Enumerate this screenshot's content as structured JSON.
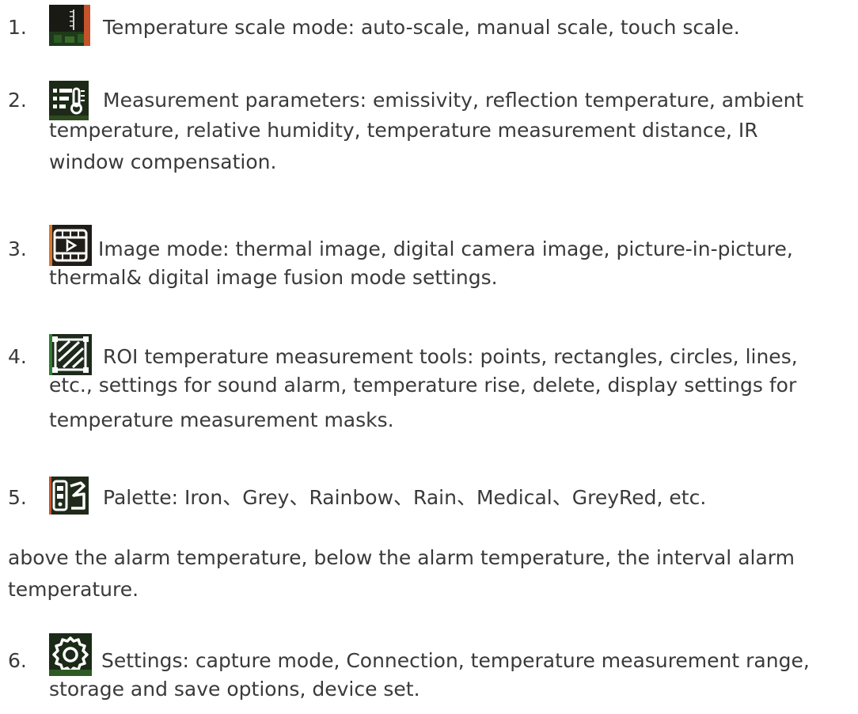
{
  "items": [
    {
      "number": "1.",
      "icon": "temperature-scale-icon",
      "lines": [
        "Temperature scale mode: auto-scale, manual scale, touch scale."
      ]
    },
    {
      "number": "2.",
      "icon": "measurement-parameters-icon",
      "lines": [
        "Measurement parameters: emissivity, reflection temperature, ambient",
        "temperature, relative humidity, temperature measurement distance, IR",
        "window compensation."
      ]
    },
    {
      "number": "3.",
      "icon": "image-mode-icon",
      "lines": [
        "Image mode: thermal image, digital camera image, picture-in-picture,",
        "thermal& digital image fusion mode settings."
      ]
    },
    {
      "number": "4.",
      "icon": "roi-tools-icon",
      "lines": [
        "ROI temperature measurement tools: points, rectangles, circles, lines,",
        "etc., settings for sound alarm, temperature rise, delete, display settings for",
        "temperature measurement masks."
      ]
    },
    {
      "number": "5.",
      "icon": "palette-icon",
      "lines": [
        "Palette: Iron、Grey、Rainbow、Rain、Medical、GreyRed, etc."
      ]
    }
  ],
  "alarm_note": {
    "lines": [
      "above the alarm temperature, below the alarm temperature, the interval alarm",
      "temperature."
    ]
  },
  "settings_item": {
    "number": "6.",
    "icon": "gear-icon",
    "lines": [
      "Settings: capture mode, Connection, temperature measurement range,",
      "storage and save options, device set."
    ]
  },
  "colors": {
    "text": "#3a3a3a",
    "icon_background": "#1f1e1c",
    "icon_accent_green": "#2e7d32",
    "icon_accent_orange": "#d9772b"
  }
}
